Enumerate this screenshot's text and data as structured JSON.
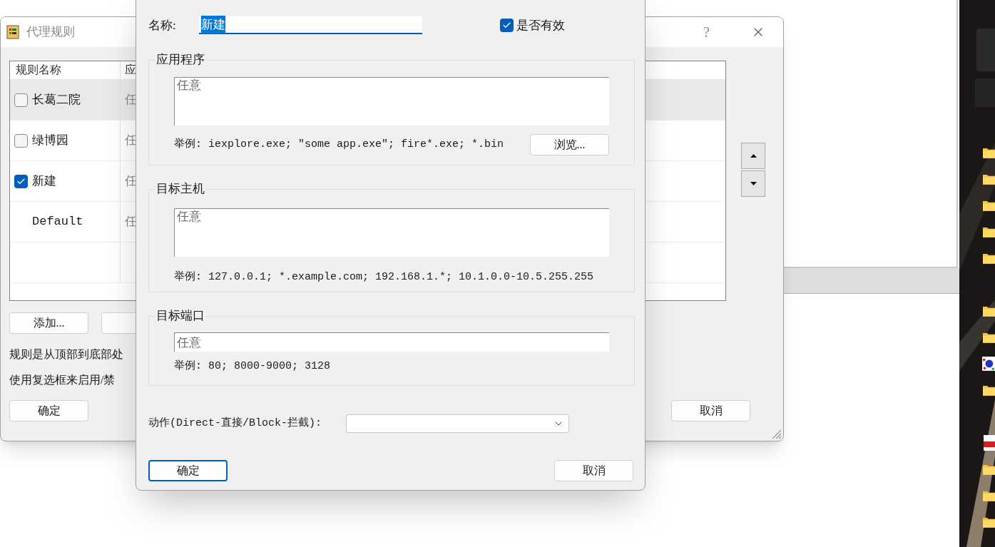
{
  "main_window": {
    "title": "代理规则",
    "help_button": "?",
    "list": {
      "columns": [
        "规则名称",
        "应"
      ],
      "rows": [
        {
          "kind": "checkbox",
          "name": "长葛二院",
          "checked": false,
          "selected": true,
          "column_2": "任"
        },
        {
          "kind": "checkbox",
          "name": "绿博园",
          "checked": false,
          "selected": false,
          "column_2": "任"
        },
        {
          "kind": "checkbox",
          "name": "新建",
          "checked": true,
          "selected": false,
          "column_2": "任"
        },
        {
          "kind": "plain",
          "name": "Default",
          "selected": false,
          "column_2": "任"
        }
      ]
    },
    "buttons": [
      "添加..."
    ],
    "notes": [
      "规则是从顶部到底部处",
      "使用复选框来启用/禁"
    ],
    "ok_button": "确定",
    "cancel_button": "取消"
  },
  "dialog": {
    "name_label": "名称:",
    "name_value": "新建",
    "name_text_selected": true,
    "enabled_label": "是否有效",
    "enabled_checked": true,
    "groups": [
      {
        "title": "应用程序",
        "kind": "multiline",
        "value": "任意",
        "example": "举例: iexplore.exe; ″some app.exe″; fire*.exe; *.bin",
        "browse_button": "浏览..."
      },
      {
        "title": "目标主机",
        "kind": "multiline",
        "value": "任意",
        "example": "举例: 127.0.0.1; *.example.com; 192.168.1.*; 10.1.0.0-10.5.255.255"
      },
      {
        "title": "目标端口",
        "kind": "single",
        "value": "任意",
        "example": "举例: 80; 8000-9000; 3128"
      }
    ],
    "action_label": "动作(Direct-直接/Block-拦截):",
    "ok_button": "确定",
    "cancel_button": "取消"
  },
  "desktop": {
    "items": [
      {
        "kind": "spacer"
      },
      {
        "kind": "folder"
      },
      {
        "kind": "folder"
      },
      {
        "kind": "folder"
      },
      {
        "kind": "folder"
      },
      {
        "kind": "folder"
      },
      {
        "kind": "spacer"
      },
      {
        "kind": "folder"
      },
      {
        "kind": "folder"
      },
      {
        "kind": "app"
      },
      {
        "kind": "folder"
      },
      {
        "kind": "spacer"
      },
      {
        "kind": "pdf"
      },
      {
        "kind": "folder"
      },
      {
        "kind": "folder"
      },
      {
        "kind": "folder"
      }
    ]
  }
}
